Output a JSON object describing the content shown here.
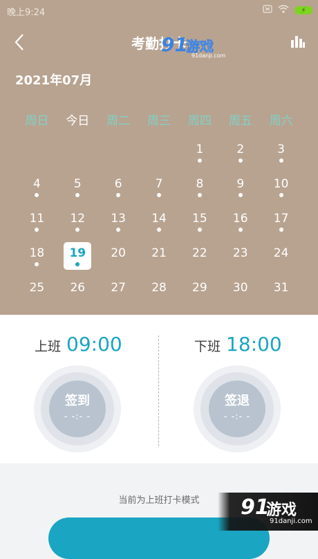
{
  "status_bar": {
    "time": "晚上9:24"
  },
  "nav": {
    "title": "考勤打卡"
  },
  "watermark_top": {
    "logo": "91",
    "text": "游戏",
    "url": "91danji.com"
  },
  "calendar": {
    "month": "2021年07月",
    "weekdays": [
      "周日",
      "今日",
      "周二",
      "周三",
      "周四",
      "周五",
      "周六"
    ],
    "weeks": [
      [
        {
          "d": "",
          "dot": false
        },
        {
          "d": "",
          "dot": false
        },
        {
          "d": "",
          "dot": false
        },
        {
          "d": "",
          "dot": false
        },
        {
          "d": "1",
          "dot": true
        },
        {
          "d": "2",
          "dot": true
        },
        {
          "d": "3",
          "dot": true
        }
      ],
      [
        {
          "d": "4",
          "dot": true
        },
        {
          "d": "5",
          "dot": true
        },
        {
          "d": "6",
          "dot": true
        },
        {
          "d": "7",
          "dot": true
        },
        {
          "d": "8",
          "dot": true
        },
        {
          "d": "9",
          "dot": true
        },
        {
          "d": "10",
          "dot": true
        }
      ],
      [
        {
          "d": "11",
          "dot": true
        },
        {
          "d": "12",
          "dot": true
        },
        {
          "d": "13",
          "dot": true
        },
        {
          "d": "14",
          "dot": true
        },
        {
          "d": "15",
          "dot": true
        },
        {
          "d": "16",
          "dot": true
        },
        {
          "d": "17",
          "dot": true
        }
      ],
      [
        {
          "d": "18",
          "dot": true
        },
        {
          "d": "19",
          "dot": true,
          "selected": true
        },
        {
          "d": "20",
          "dot": false
        },
        {
          "d": "21",
          "dot": false
        },
        {
          "d": "22",
          "dot": false
        },
        {
          "d": "23",
          "dot": false
        },
        {
          "d": "24",
          "dot": false
        }
      ],
      [
        {
          "d": "25",
          "dot": false
        },
        {
          "d": "26",
          "dot": false
        },
        {
          "d": "27",
          "dot": false
        },
        {
          "d": "28",
          "dot": false
        },
        {
          "d": "29",
          "dot": false
        },
        {
          "d": "30",
          "dot": false
        },
        {
          "d": "31",
          "dot": false
        }
      ]
    ]
  },
  "work": {
    "start": {
      "label": "上班",
      "time": "09:00",
      "action": "签到",
      "placeholder": "- -:- -"
    },
    "end": {
      "label": "下班",
      "time": "18:00",
      "action": "签退",
      "placeholder": "- -:- -"
    }
  },
  "mode_text": "当前为上班打卡模式",
  "watermark_bottom": {
    "logo": "91",
    "text": "游戏",
    "url": "91danji.com"
  },
  "colors": {
    "header_bg": "#b8a390",
    "accent": "#1aa5c2",
    "weekday": "#7fd2c9"
  }
}
